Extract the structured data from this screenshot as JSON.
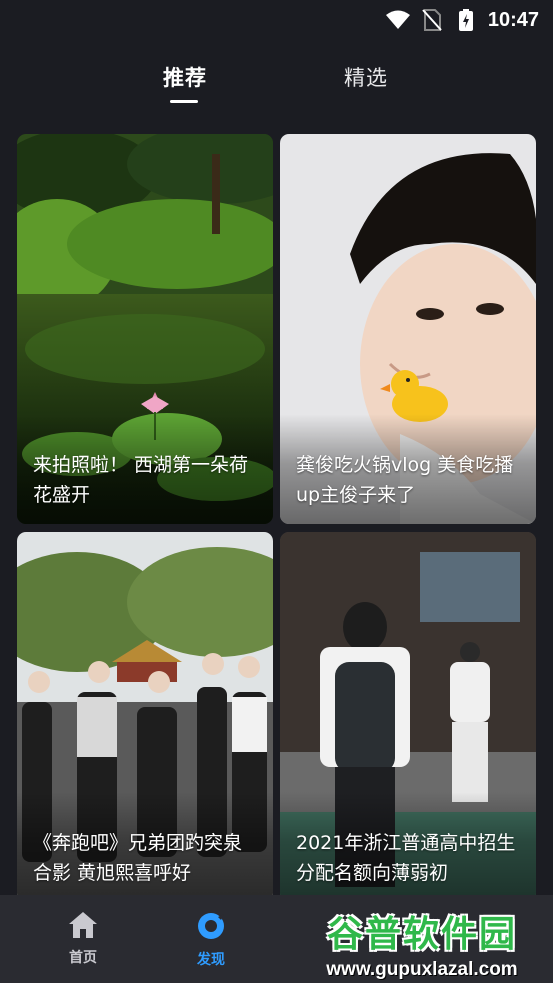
{
  "status_bar": {
    "time": "10:47"
  },
  "tabs": [
    {
      "label": "推荐",
      "active": true
    },
    {
      "label": "精选",
      "active": false
    }
  ],
  "cards": [
    {
      "caption": "来拍照啦！  西湖第一朵荷花盛开"
    },
    {
      "caption": "龚俊吃火锅vlog 美食吃播up主俊子来了"
    },
    {
      "caption": "《奔跑吧》兄弟团趵突泉合影 黄旭熙喜呼好"
    },
    {
      "caption": "2021年浙江普通高中招生 分配名额向薄弱初"
    }
  ],
  "bottom_nav": [
    {
      "label": "首页",
      "icon": "home-icon",
      "active": false
    },
    {
      "label": "发现",
      "icon": "discover-icon",
      "active": true
    }
  ],
  "watermark": {
    "name": "谷普软件园",
    "url": "www.gupuxlazal.com"
  },
  "colors": {
    "background": "#1b1c22",
    "nav_bg": "#2a2b31",
    "accent": "#2f9cff",
    "watermark_green": "#2fb84a"
  }
}
